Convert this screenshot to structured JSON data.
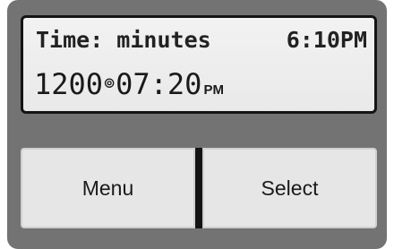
{
  "display": {
    "line1_label": "Time: minutes",
    "line1_time": "6:10PM",
    "line2_prefix": "1200",
    "line2_alarm_icon": "alarm-spiral-icon",
    "line2_alarm_glyph": "⊚",
    "line2_time": "07:20",
    "line2_ampm": "PM"
  },
  "buttons": {
    "menu_label": "Menu",
    "select_label": "Select"
  },
  "colors": {
    "bezel": "#737373",
    "screen": "#ececec",
    "text": "#1a1a1a",
    "button": "#e6e6e6"
  }
}
